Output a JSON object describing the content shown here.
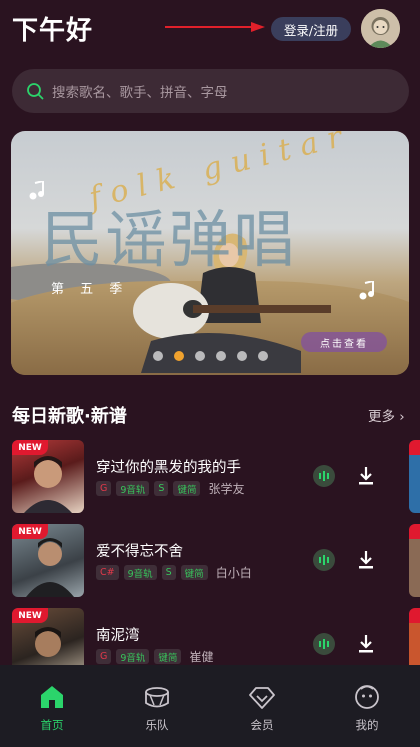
{
  "header": {
    "greeting": "下午好",
    "login_label": "登录/注册"
  },
  "search": {
    "placeholder": "搜索歌名、歌手、拼音、字母"
  },
  "banner": {
    "script_text": "folk guitar",
    "title": "民谣弹唱",
    "season": "第 五 季",
    "cta": "点击查看",
    "slide_count": 6,
    "active_slide": 1
  },
  "daily": {
    "title": "每日新歌·新谱",
    "more_label": "更多"
  },
  "songs": [
    {
      "badge": "NEW",
      "title": "穿过你的黑发的我的手",
      "tags": [
        "G",
        "9音轨",
        "S",
        "键简"
      ],
      "artist": "张学友"
    },
    {
      "badge": "NEW",
      "title": "爱不得忘不舍",
      "tags": [
        "C#",
        "9音轨",
        "S",
        "键简"
      ],
      "artist": "白小白"
    },
    {
      "badge": "NEW",
      "title": "南泥湾",
      "tags": [
        "G",
        "9音轨",
        "键简"
      ],
      "artist": "崔健"
    }
  ],
  "nav": {
    "items": [
      {
        "label": "首页",
        "icon": "home-icon",
        "active": true
      },
      {
        "label": "乐队",
        "icon": "drum-icon",
        "active": false
      },
      {
        "label": "会员",
        "icon": "diamond-icon",
        "active": false
      },
      {
        "label": "我的",
        "icon": "face-icon",
        "active": false
      }
    ]
  },
  "colors": {
    "background": "#2a1320",
    "accent_green": "#2bd46b",
    "badge_red": "#e0192f",
    "dot_active": "#f0a22e"
  }
}
